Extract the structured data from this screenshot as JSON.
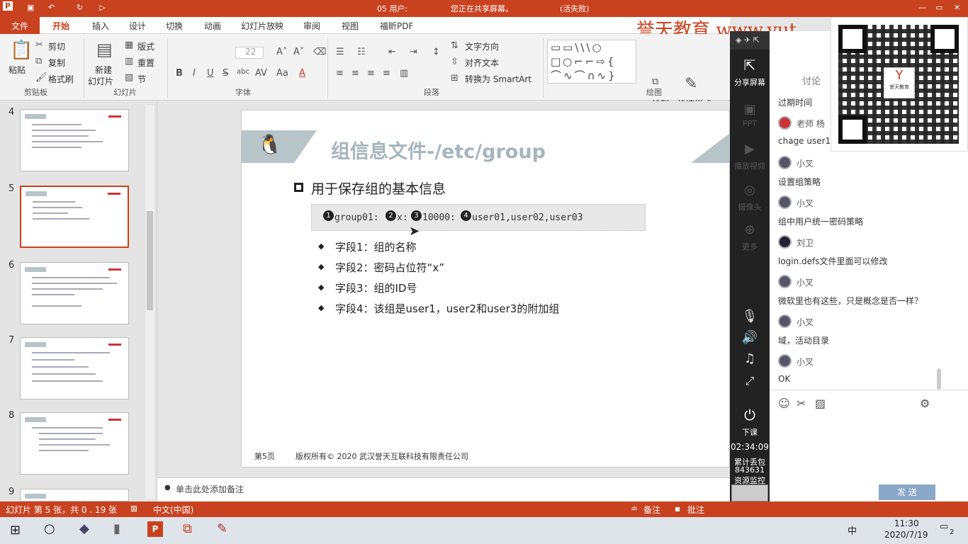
{
  "titlebar": {
    "filename": "05 用户:",
    "sharing": "您正在共享屏幕。",
    "status": "(活失败)",
    "logo_word": "P"
  },
  "tabs": [
    "文件",
    "开始",
    "插入",
    "设计",
    "切换",
    "动画",
    "幻灯片放映",
    "审阅",
    "视图",
    "福昕PDF"
  ],
  "watermark": "誉天教育 www.yut",
  "ribbon": {
    "clipboard": {
      "paste": "粘贴",
      "cut": "剪切",
      "copy": "复制",
      "format_painter": "格式刷",
      "group": "剪贴板"
    },
    "slides": {
      "new_slide": "新建",
      "new_slide2": "幻灯片",
      "layout": "版式",
      "reset": "重置",
      "section": "节",
      "group": "幻灯片"
    },
    "font": {
      "size": "22",
      "group": "字体",
      "buttons": [
        "B",
        "I",
        "U",
        "S",
        "abc",
        "AV",
        "Aa",
        "A"
      ]
    },
    "paragraph": {
      "text_direction": "文字方向",
      "align_text": "对齐文本",
      "smartart": "转换为 SmartArt",
      "group": "段落"
    },
    "drawing": {
      "arrange": "排列",
      "quick_styles": "快速样式",
      "group": "绘图"
    }
  },
  "slide_panel": {
    "numbers": [
      "4",
      "5",
      "6",
      "7",
      "8",
      "9"
    ],
    "active": "5"
  },
  "slide": {
    "title": "组信息文件-/etc/group",
    "main_bullet": "用于保存组的基本信息",
    "code": [
      "group01:",
      "x:",
      "10000:",
      "user01,user02,user03"
    ],
    "code_marks": [
      "1",
      "2",
      "3",
      "4"
    ],
    "fields": [
      "字段1：组的名称",
      "字段2：密码占位符“x”",
      "字段3：组的ID号",
      "字段4：该组是user1，user2和user3的附加组"
    ],
    "footer_page": "第5页",
    "footer_copy": "版权所有© 2020 武汉誉天互联科技有限责任公司"
  },
  "notes": "单击此处添加备注",
  "status": {
    "slide_info": "幻灯片 第 5 张，共 0 . 19 张",
    "lang": "中文(中国)",
    "notes_btn": "备注",
    "comments_btn": "批注"
  },
  "sidebar": {
    "share": "分享屏幕",
    "ppt": "PPT",
    "video": "播放视频",
    "cam": "摄像头",
    "more": "更多",
    "end": "下课",
    "timer": "02:34:09",
    "loss_label": "累计丢包",
    "loss_value": "843631",
    "resource": "资源监控"
  },
  "chat": {
    "tab": "讨论",
    "top": "过期时间",
    "messages": [
      {
        "name": "老师  杨",
        "text": "chage  user1"
      },
      {
        "name": "小叉",
        "text": "设置组策略"
      },
      {
        "name": "小叉",
        "text": "组中用户统一密码策略"
      },
      {
        "name": "刘卫",
        "text": "login.defs文件里面可以修改"
      },
      {
        "name": "小叉",
        "text": "微软里也有这些，只是概念是否一样？"
      },
      {
        "name": "小叉",
        "text": "域，活动目录"
      },
      {
        "name": "小叉",
        "text": "OK"
      }
    ],
    "send": "发 送"
  },
  "qr": {
    "brand": "誉天教育"
  },
  "taskbar": {
    "time": "11:30",
    "date": "2020/7/19",
    "ime": "中",
    "notif": "2"
  }
}
